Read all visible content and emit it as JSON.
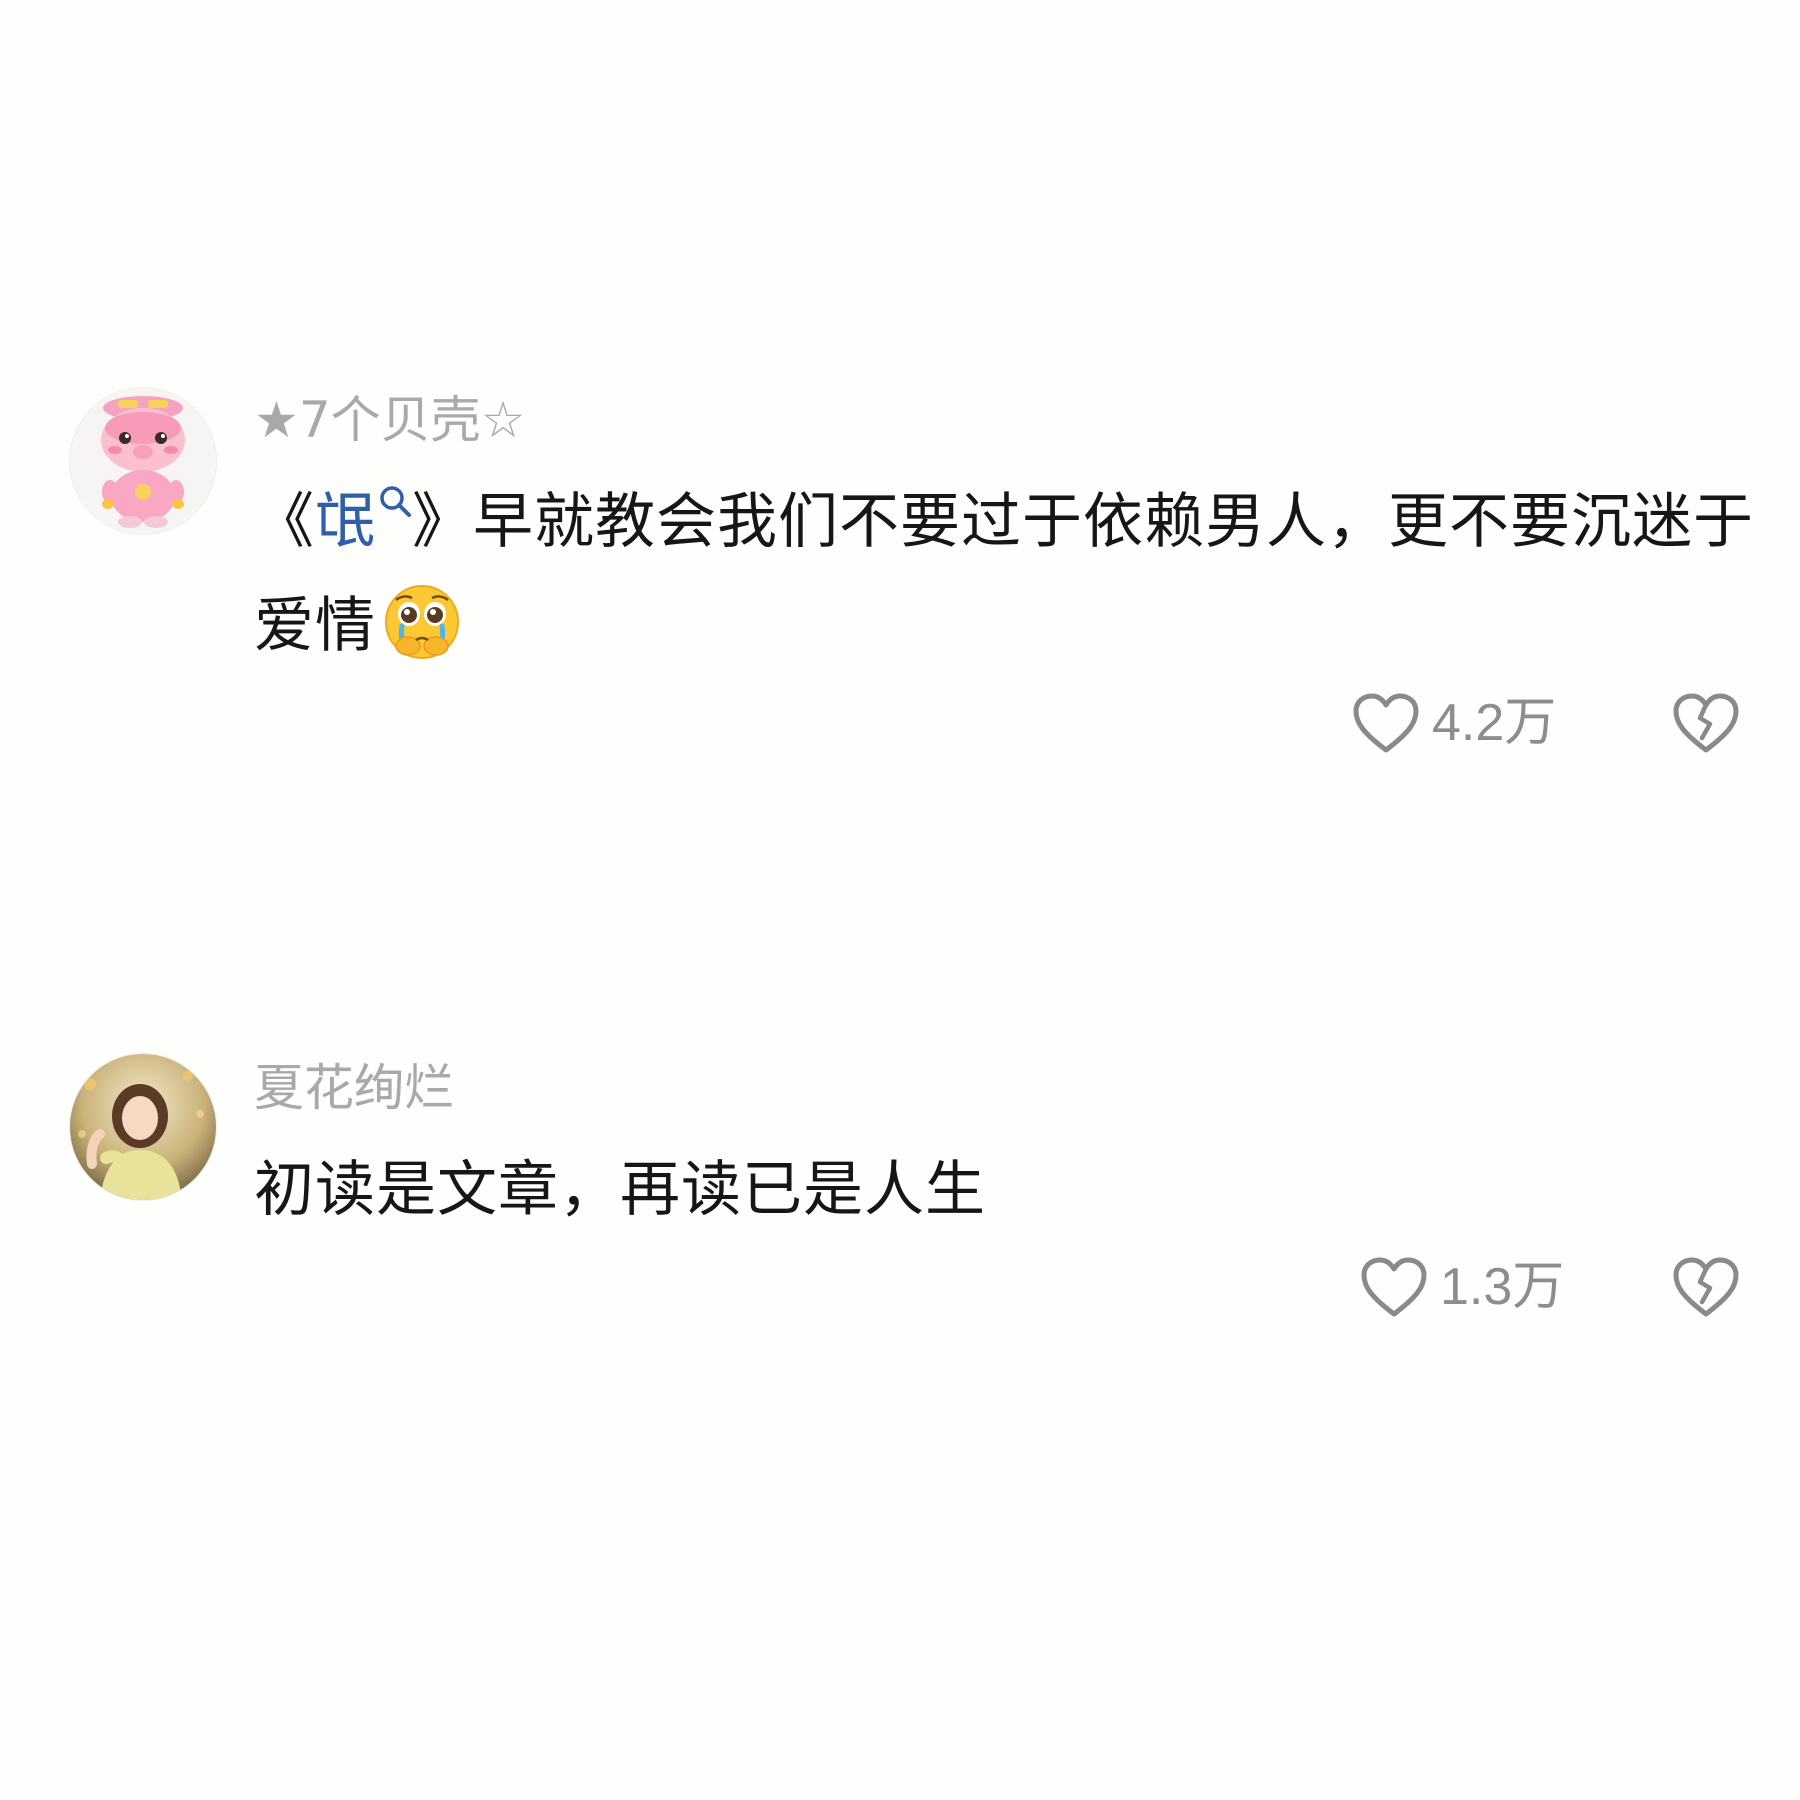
{
  "comments": [
    {
      "username": "★7个贝壳☆",
      "text_open": "《",
      "text_link": "氓",
      "text_close": "》早就教会我们不要过于依赖男人，更不要沉迷于爱情",
      "emoji": "pleading-crying-face",
      "like_count": "4.2万",
      "avatar": "pink-cartoon-pig-avatar"
    },
    {
      "username": "夏花绚烂",
      "text": "初读是文章，再读已是人生",
      "like_count": "1.3万",
      "avatar": "girl-in-yellow-photo-avatar"
    }
  ],
  "colors": {
    "background": "#fefefd",
    "username": "#a9a9a9",
    "text": "#161616",
    "link": "#2f5fa8",
    "icon": "#8a8a8a"
  }
}
